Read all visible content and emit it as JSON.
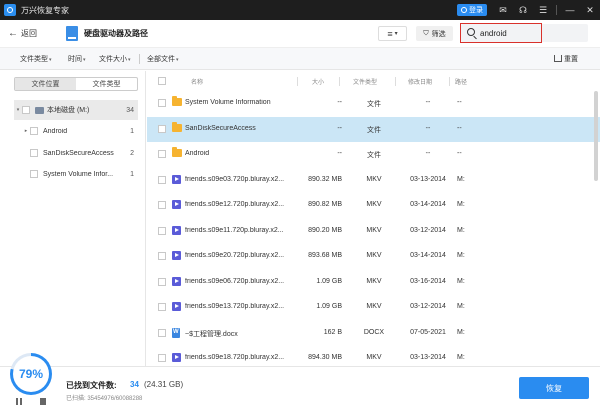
{
  "titlebar": {
    "title": "万兴恢复专家",
    "login_label": "登录"
  },
  "header": {
    "back_label": "返回",
    "title": "硬盘驱动器及路径",
    "filter_label": "筛选",
    "search_value": "android"
  },
  "filters": {
    "type_label": "文件类型",
    "time_label": "时间",
    "size_label": "文件大小",
    "all_label": "全部文件",
    "reset_label": "重置"
  },
  "sidebar": {
    "tabs": [
      {
        "label": "文件位置",
        "active": true
      },
      {
        "label": "文件类型",
        "active": false
      }
    ],
    "tree": [
      {
        "label": "本地磁盘 (M:)",
        "count": "34"
      },
      {
        "label": "Android",
        "count": "1"
      },
      {
        "label": "SanDiskSecureAccess",
        "count": "2"
      },
      {
        "label": "System Volume Infor...",
        "count": "1"
      }
    ]
  },
  "table": {
    "headers": {
      "name": "名称",
      "size": "大小",
      "type": "文件类型",
      "date": "修改日期",
      "path": "路径"
    },
    "rows": [
      {
        "icon": "folder-icon",
        "name": "System Volume Information",
        "size": "--",
        "type": "文件",
        "date": "--",
        "path": "--",
        "selected": false
      },
      {
        "icon": "folder-icon",
        "name": "SanDiskSecureAccess",
        "size": "--",
        "type": "文件",
        "date": "--",
        "path": "--",
        "selected": true
      },
      {
        "icon": "folder-icon",
        "name": "Android",
        "size": "--",
        "type": "文件",
        "date": "--",
        "path": "--",
        "selected": false
      },
      {
        "icon": "video-icon",
        "name": "friends.s09e03.720p.bluray.x2...",
        "size": "890.32 MB",
        "type": "MKV",
        "date": "03-13-2014",
        "path": "M:",
        "selected": false
      },
      {
        "icon": "video-icon",
        "name": "friends.s09e12.720p.bluray.x2...",
        "size": "890.82 MB",
        "type": "MKV",
        "date": "03-14-2014",
        "path": "M:",
        "selected": false
      },
      {
        "icon": "video-icon",
        "name": "friends.s09e11.720p.bluray.x2...",
        "size": "890.20 MB",
        "type": "MKV",
        "date": "03-12-2014",
        "path": "M:",
        "selected": false
      },
      {
        "icon": "video-icon",
        "name": "friends.s09e20.720p.bluray.x2...",
        "size": "893.68 MB",
        "type": "MKV",
        "date": "03-14-2014",
        "path": "M:",
        "selected": false
      },
      {
        "icon": "video-icon",
        "name": "friends.s09e06.720p.bluray.x2...",
        "size": "1.09 GB",
        "type": "MKV",
        "date": "03-16-2014",
        "path": "M:",
        "selected": false
      },
      {
        "icon": "video-icon",
        "name": "friends.s09e13.720p.bluray.x2...",
        "size": "1.09 GB",
        "type": "MKV",
        "date": "03-12-2014",
        "path": "M:",
        "selected": false
      },
      {
        "icon": "doc-icon",
        "name": "~$工程管理.docx",
        "size": "162 B",
        "type": "DOCX",
        "date": "07-05-2021",
        "path": "M:",
        "selected": false
      },
      {
        "icon": "video-icon",
        "name": "friends.s09e18.720p.bluray.x2...",
        "size": "894.30 MB",
        "type": "MKV",
        "date": "03-13-2014",
        "path": "M:",
        "selected": false
      }
    ]
  },
  "footer": {
    "progress": "79%",
    "progress_value": 79,
    "found_label": "已找到文件数:",
    "found_count": "34",
    "found_size": "(24.31 GB)",
    "scanned": "已扫描: 35454976/60088288",
    "recover_label": "恢复"
  },
  "colors": {
    "accent": "#2a8cf0",
    "selected_row": "#cbe6f6",
    "search_highlight": "#d9312b",
    "titlebar": "#1e1e1e"
  }
}
